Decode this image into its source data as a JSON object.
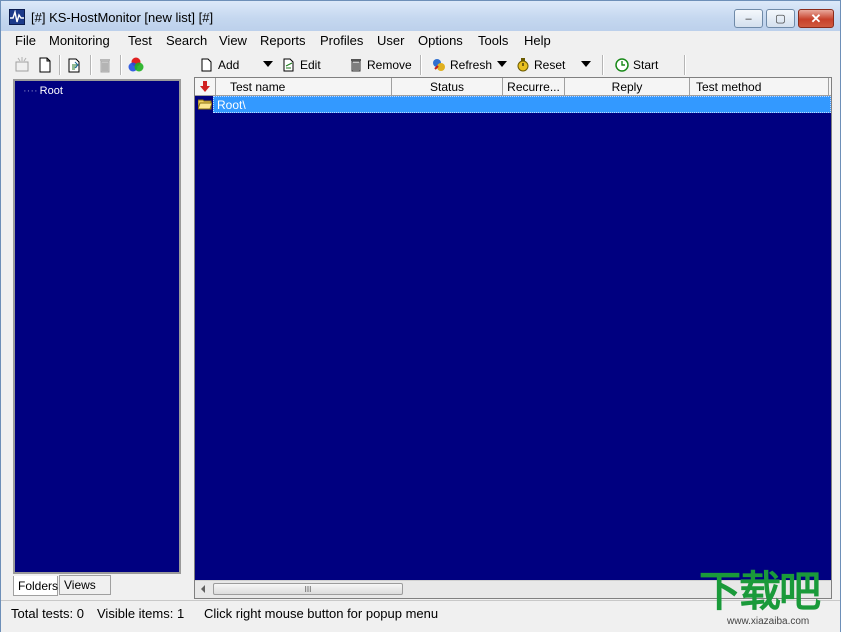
{
  "window": {
    "title": "[#] KS-HostMonitor  [new list] [#]",
    "controls": {
      "minimize": "–",
      "maximize": "▢",
      "close": "✕"
    }
  },
  "menu": [
    "File",
    "Monitoring",
    "Test",
    "Search",
    "View",
    "Reports",
    "Profiles",
    "User",
    "Options",
    "Tools",
    "Help"
  ],
  "left_toolbar": {
    "icons": [
      "new-folder-icon",
      "new-item-icon",
      "copy-folder-icon",
      "delete-folder-icon",
      "colors-icon"
    ]
  },
  "tree": {
    "root_label": "Root"
  },
  "tabs": {
    "folders": "Folders",
    "views": "Views"
  },
  "right_toolbar": {
    "add": "Add",
    "edit": "Edit",
    "remove": "Remove",
    "refresh": "Refresh",
    "reset": "Reset",
    "start": "Start"
  },
  "list": {
    "columns": [
      "Test name",
      "Status",
      "Recurre...",
      "Reply",
      "Test method"
    ],
    "rows": [
      {
        "name": "Root\\",
        "type": "folder",
        "selected": true
      }
    ]
  },
  "scrollbar": {
    "thumb_grip": "III"
  },
  "status": {
    "total_tests": "Total tests: 0",
    "visible_items": "Visible items: 1",
    "hint": "Click right mouse button for popup menu"
  },
  "watermark": {
    "logo": "下载吧",
    "url": "www.xiazaiba.com"
  },
  "colors": {
    "list_background": "#000080",
    "selection": "#3399ff",
    "watermark_green": "#1a9a3a"
  }
}
